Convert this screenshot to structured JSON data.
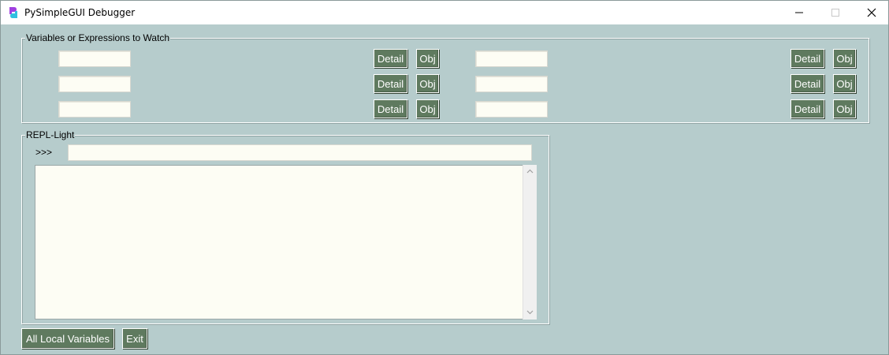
{
  "window": {
    "title": "PySimpleGUI Debugger",
    "icon": "pysimplegui-logo-icon"
  },
  "watch": {
    "label": "Variables or Expressions to Watch",
    "rows": [
      {
        "left_value": "",
        "right_value": ""
      },
      {
        "left_value": "",
        "right_value": ""
      },
      {
        "left_value": "",
        "right_value": ""
      }
    ],
    "detail_label": "Detail",
    "obj_label": "Obj"
  },
  "repl": {
    "label": "REPL-Light",
    "prompt": ">>>",
    "input_value": "",
    "output": ""
  },
  "footer": {
    "all_locals_label": "All Local Variables",
    "exit_label": "Exit"
  },
  "colors": {
    "background": "#b6cccc",
    "button": "#5f7a5f",
    "input": "#fdfdf4"
  }
}
